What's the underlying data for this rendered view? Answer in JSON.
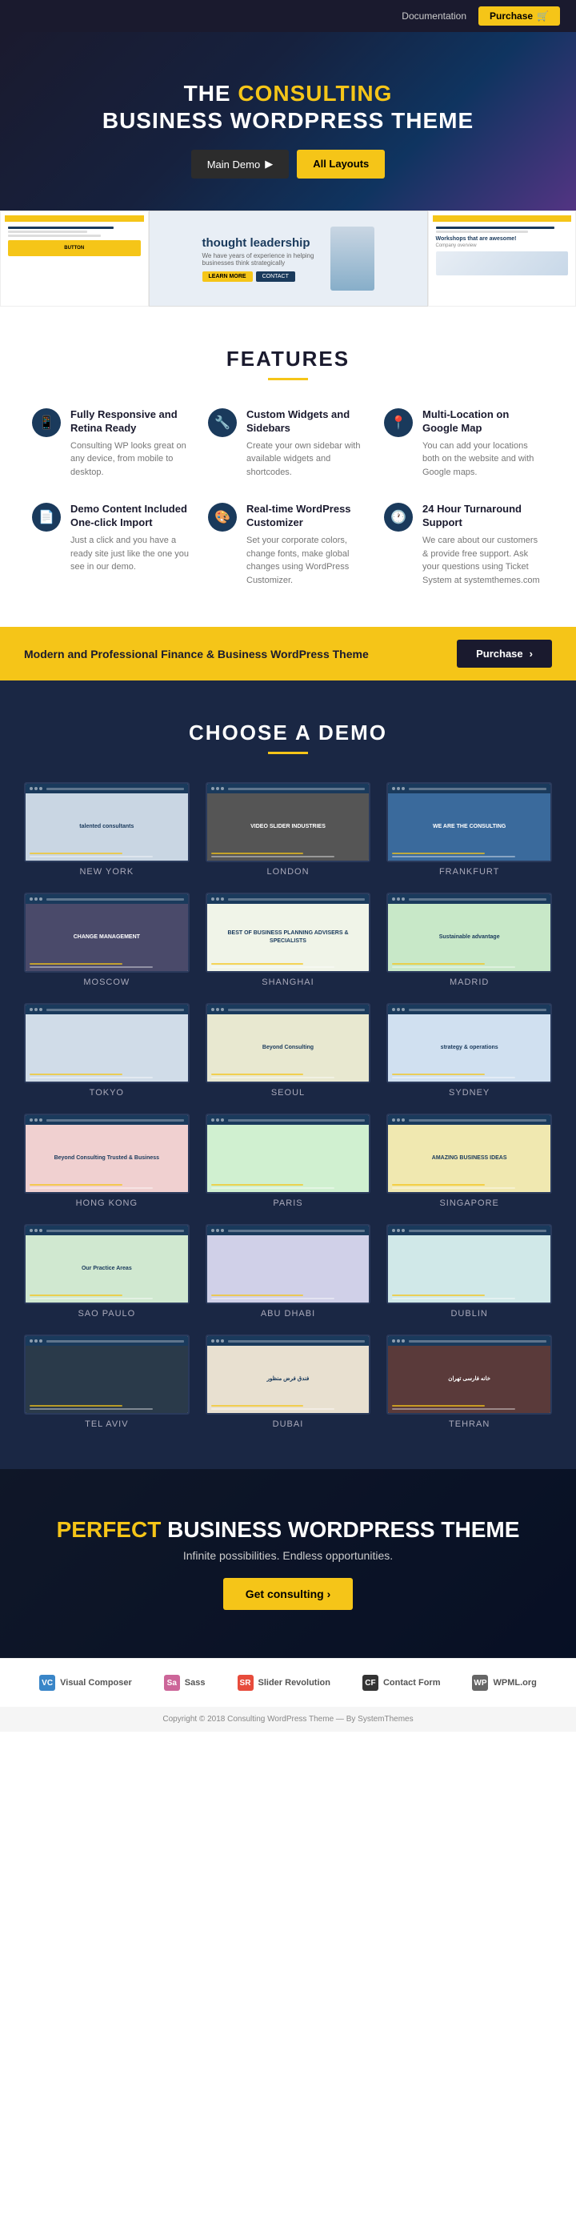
{
  "topbar": {
    "docs_label": "Documentation",
    "purchase_label": "Purchase",
    "cart_icon": "🛒"
  },
  "hero": {
    "title_line1": "THE",
    "title_highlight": "CONSULTING",
    "title_line2": "BUSINESS WORDPRESS THEME",
    "btn_main_demo": "Main Demo",
    "btn_play_icon": "▶",
    "btn_all_layouts": "All Layouts"
  },
  "preview": {
    "thought_leadership": "thought leadership",
    "subtitle": "We have years of experience in helping businesses think strategically",
    "right_label": "Workshops that are awesome!",
    "right_sub": "Company overview"
  },
  "features": {
    "section_title": "FEATURES",
    "items": [
      {
        "icon": "📱",
        "title": "Fully Responsive and Retina Ready",
        "desc": "Consulting WP looks great on any device, from mobile to desktop."
      },
      {
        "icon": "🔧",
        "title": "Custom Widgets and Sidebars",
        "desc": "Create your own sidebar with available widgets and shortcodes."
      },
      {
        "icon": "📍",
        "title": "Multi-Location on Google Map",
        "desc": "You can add your locations both on the website and with Google maps."
      },
      {
        "icon": "📄",
        "title": "Demo Content Included One-click Import",
        "desc": "Just a click and you have a ready site just like the one you see in our demo."
      },
      {
        "icon": "🎨",
        "title": "Real-time WordPress Customizer",
        "desc": "Set your corporate colors, change fonts, make global changes using WordPress Customizer."
      },
      {
        "icon": "🕐",
        "title": "24 Hour Turnaround Support",
        "desc": "We care about our customers & provide free support. Ask your questions using Ticket System at systemthemes.com"
      }
    ]
  },
  "cta_banner": {
    "text": "Modern and Professional Finance & Business WordPress Theme",
    "btn_label": "Purchase",
    "btn_icon": "›"
  },
  "demos": {
    "section_title": "CHOOSE A DEMO",
    "items": [
      {
        "label": "NEW YORK",
        "class": "demo-ny",
        "text": "talented consultants"
      },
      {
        "label": "LONDON",
        "class": "demo-london",
        "text": "VIDEO SLIDER\nINDUSTRIES"
      },
      {
        "label": "FRANKFURT",
        "class": "demo-frankfurt",
        "text": "WE ARE THE CONSULTING"
      },
      {
        "label": "MOSCOW",
        "class": "demo-moscow",
        "text": "CHANGE MANAGEMENT"
      },
      {
        "label": "SHANGHAI",
        "class": "demo-shanghai",
        "text": "BEST OF BUSINESS PLANNING ADVISERS & SPECIALISTS"
      },
      {
        "label": "MADRID",
        "class": "demo-madrid",
        "text": "Sustainable advantage"
      },
      {
        "label": "TOKYO",
        "class": "demo-tokyo",
        "text": ""
      },
      {
        "label": "SEOUL",
        "class": "demo-seoul",
        "text": "Beyond Consulting"
      },
      {
        "label": "SYDNEY",
        "class": "demo-sydney",
        "text": "strategy & operations"
      },
      {
        "label": "HONG KONG",
        "class": "demo-hk",
        "text": "Beyond Consulting\nTrusted & Business"
      },
      {
        "label": "PARIS",
        "class": "demo-paris",
        "text": ""
      },
      {
        "label": "SINGAPORE",
        "class": "demo-singapore",
        "text": "AMAZING BUSINESS IDEAS"
      },
      {
        "label": "SAO PAULO",
        "class": "demo-saopaulo",
        "text": "Our Practice Areas"
      },
      {
        "label": "ABU DHABI",
        "class": "demo-abudhabi",
        "text": ""
      },
      {
        "label": "DUBLIN",
        "class": "demo-dublin",
        "text": ""
      },
      {
        "label": "TEL AVIV",
        "class": "demo-telaviv",
        "text": ""
      },
      {
        "label": "DUBAI",
        "class": "demo-dubai",
        "text": "فندق فرض منظور"
      },
      {
        "label": "TEHRAN",
        "class": "demo-tehran",
        "text": "خانه فارسی تهران"
      }
    ]
  },
  "bottom_cta": {
    "title_highlight": "PERFECT",
    "title_rest": " BUSINESS WORDPRESS THEME",
    "subtitle": "Infinite possibilities. Endless opportunities.",
    "btn_label": "Get consulting ›"
  },
  "footer": {
    "logos": [
      {
        "name": "Visual Composer",
        "icon": "VC"
      },
      {
        "name": "Sass",
        "icon": "Sass"
      },
      {
        "name": "Slider Revolution",
        "icon": "SR"
      },
      {
        "name": "Contact Form",
        "icon": "CF"
      },
      {
        "name": "WPML.org",
        "icon": "WP"
      }
    ],
    "copyright": "Copyright © 2018 Consulting WordPress Theme",
    "by": "By SystemThemes"
  }
}
